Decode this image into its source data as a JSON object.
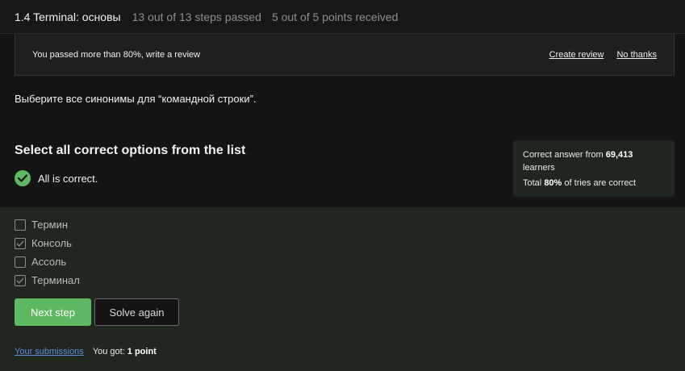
{
  "header": {
    "lesson_title": "1.4 Terminal: основы",
    "steps_status": "13 out of 13 steps passed",
    "points_status": "5 out of 5 points  received"
  },
  "review_banner": {
    "message": "You passed more than 80%, write a review",
    "create_review": "Create review",
    "no_thanks": "No thanks"
  },
  "question": {
    "text": "Выберите все синонимы для “командной строки”."
  },
  "quiz": {
    "title": "Select all correct options from the list",
    "status": "All is correct."
  },
  "stats": {
    "correct_prefix": "Correct answer from",
    "learners_count": "69,413",
    "learners_suffix": "learners",
    "total_prefix": "Total",
    "total_percent": "80%",
    "total_suffix": "of tries are correct"
  },
  "options": [
    {
      "label": "Термин",
      "checked": false
    },
    {
      "label": "Консоль",
      "checked": true
    },
    {
      "label": "Ассоль",
      "checked": false
    },
    {
      "label": "Терминал",
      "checked": true
    }
  ],
  "actions": {
    "next_step": "Next step",
    "solve_again": "Solve again"
  },
  "footer": {
    "submissions_link": "Your submissions",
    "you_got": "You got:",
    "score": "1 point"
  },
  "colors": {
    "accent_green": "#5fb862",
    "panel_green": "#1f271e",
    "link_blue": "#5b8fdb"
  }
}
